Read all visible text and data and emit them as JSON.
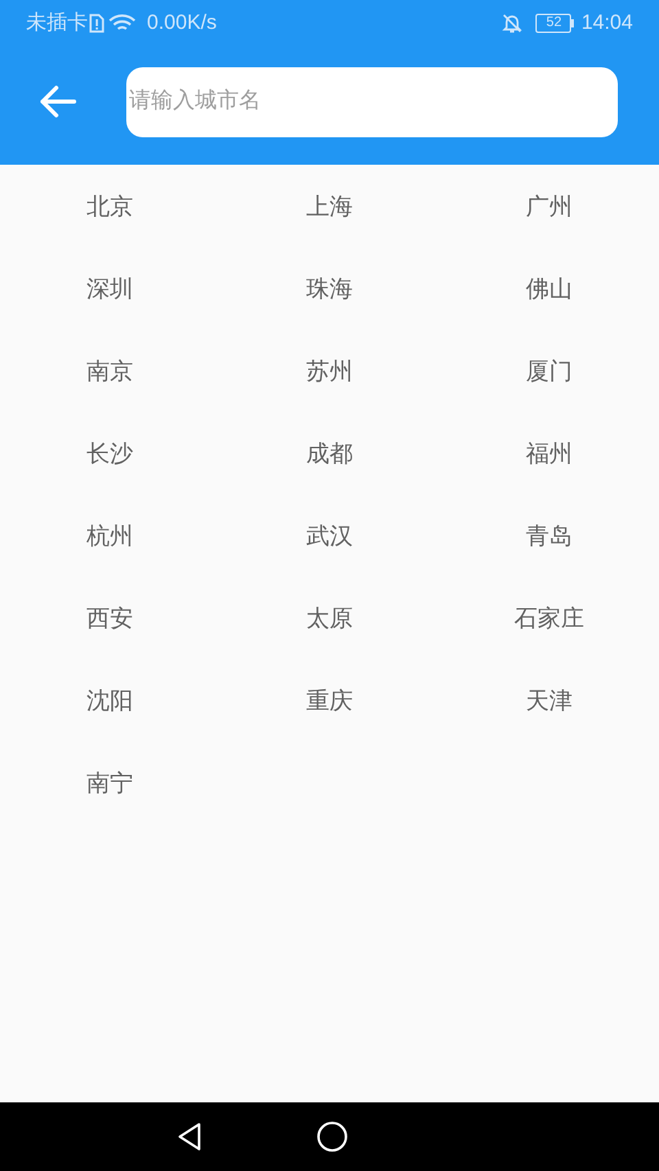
{
  "status_bar": {
    "carrier": "未插卡",
    "speed": "0.00K/s",
    "battery": "52",
    "time": "14:04"
  },
  "search": {
    "placeholder": "请输入城市名"
  },
  "cities": [
    "北京",
    "上海",
    "广州",
    "深圳",
    "珠海",
    "佛山",
    "南京",
    "苏州",
    "厦门",
    "长沙",
    "成都",
    "福州",
    "杭州",
    "武汉",
    "青岛",
    "西安",
    "太原",
    "石家庄",
    "沈阳",
    "重庆",
    "天津",
    "南宁"
  ]
}
